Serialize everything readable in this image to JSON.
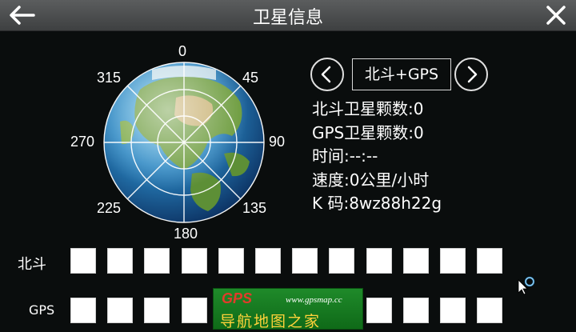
{
  "window": {
    "title": "卫星信息",
    "back_icon": "arrow-left-icon",
    "close_icon": "close-icon"
  },
  "sky_view": {
    "labels": {
      "n": "0",
      "ne": "45",
      "e": "90",
      "se": "135",
      "s": "180",
      "sw": "225",
      "w": "270",
      "nw": "315"
    }
  },
  "mode_selector": {
    "label": "北斗+GPS",
    "prev_icon": "chevron-left-icon",
    "next_icon": "chevron-right-icon"
  },
  "info": {
    "beidou_count": "北斗卫星颗数:0",
    "gps_count": "GPS卫星颗数:0",
    "time": "时间:--:--",
    "speed": "速度:0公里/小时",
    "code": "K 码:8wz88h22g"
  },
  "satellite_rows": [
    {
      "label": "北斗",
      "slots": 12
    },
    {
      "label": "GPS",
      "slots": 12
    }
  ],
  "watermark": {
    "brand": "GPS",
    "url": "www.gpsmap.cc",
    "tagline": "导航地图之家"
  },
  "colors": {
    "titlebar": "#4d4f50",
    "background": "#0a0d0d",
    "slot": "#ffffff",
    "watermark_green": "#1a7f24"
  }
}
